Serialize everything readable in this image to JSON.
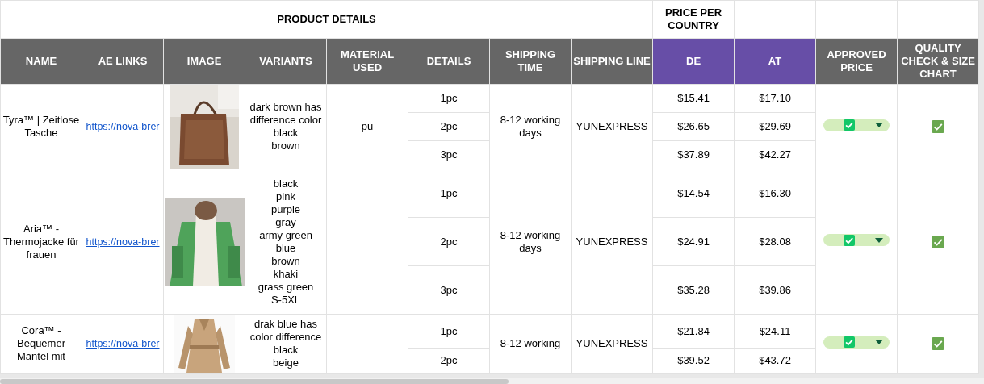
{
  "header_groups": [
    {
      "label": "PRODUCT DETAILS"
    },
    {
      "label": "PRICE PER COUNTRY"
    }
  ],
  "columns": [
    {
      "label": "NAME",
      "kind": "plain"
    },
    {
      "label": "AE LINKS",
      "kind": "plain"
    },
    {
      "label": "IMAGE",
      "kind": "plain"
    },
    {
      "label": "VARIANTS",
      "kind": "plain"
    },
    {
      "label": "MATERIAL USED",
      "kind": "plain"
    },
    {
      "label": "DETAILS",
      "kind": "plain"
    },
    {
      "label": "SHIPPING TIME",
      "kind": "plain"
    },
    {
      "label": "SHIPPING LINE",
      "kind": "plain"
    },
    {
      "label": "DE",
      "kind": "country"
    },
    {
      "label": "AT",
      "kind": "country"
    },
    {
      "label": "APPROVED PRICE",
      "kind": "plain"
    },
    {
      "label": "QUALITY CHECK & SIZE CHART",
      "kind": "plain"
    }
  ],
  "products": [
    {
      "name": "Tyra™ | Zeitlose Tasche",
      "link": "https://nova-brer",
      "image": {
        "kind": "picture"
      },
      "variants": [
        "dark brown has",
        "difference color",
        "black",
        "brown"
      ],
      "material": "pu",
      "tiers": [
        {
          "qty": "1pc",
          "de": "$15.41",
          "at": "$17.10"
        },
        {
          "qty": "2pc",
          "de": "$26.65",
          "at": "$29.69"
        },
        {
          "qty": "3pc",
          "de": "$37.89",
          "at": "$42.27"
        }
      ],
      "shipping_time": "8-12 working days",
      "shipping_line": "YUNEXPRESS",
      "approved": true,
      "quality_checked": true
    },
    {
      "name": "Aria™ - Thermojacke für frauen",
      "link": "https://nova-brer",
      "image": {
        "kind": "picture"
      },
      "variants": [
        "black",
        "pink",
        "purple",
        "gray",
        "army green",
        "blue",
        "brown",
        "khaki",
        "grass green",
        "S-5XL"
      ],
      "tiers": [
        {
          "qty": "1pc",
          "de": "$14.54",
          "at": "$16.30"
        },
        {
          "qty": "2pc",
          "de": "$24.91",
          "at": "$28.08"
        },
        {
          "qty": "3pc",
          "de": "$35.28",
          "at": "$39.86"
        }
      ],
      "shipping_time": "8-12 working days",
      "shipping_line": "YUNEXPRESS",
      "approved": true,
      "quality_checked": true
    },
    {
      "name": "Cora™ - Bequemer Mantel mit",
      "link": "https://nova-brer",
      "image": {
        "kind": "picture"
      },
      "variants": [
        "drak blue has",
        "color difference",
        "black",
        "beige"
      ],
      "tiers": [
        {
          "qty": "1pc",
          "de": "$21.84",
          "at": "$24.11"
        },
        {
          "qty": "2pc",
          "de": "$39.52",
          "at": "$43.72"
        }
      ],
      "shipping_time": "8-12 working",
      "shipping_line": "YUNEXPRESS",
      "approved": true,
      "quality_checked": true
    }
  ]
}
